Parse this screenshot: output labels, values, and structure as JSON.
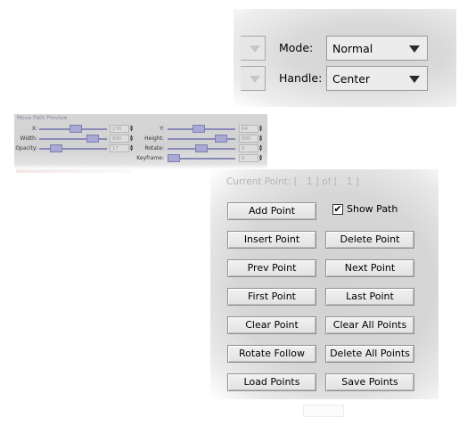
{
  "mode_panel": {
    "mode_label": "Mode:",
    "mode_value": "Normal",
    "handle_label": "Handle:",
    "handle_value": "Center"
  },
  "preview": {
    "title": "Move Path Preview",
    "fields": {
      "x": {
        "label": "X:",
        "value": "176",
        "slider": 0.55
      },
      "width": {
        "label": "Width:",
        "value": "800",
        "slider": 0.85
      },
      "opacity": {
        "label": "Opacity:",
        "value": "17",
        "slider": 0.2
      },
      "y": {
        "label": "Y:",
        "value": "64",
        "slider": 0.45
      },
      "height": {
        "label": "Height:",
        "value": "800",
        "slider": 0.85
      },
      "rotate": {
        "label": "Rotate:",
        "value": "0",
        "slider": 0.5
      },
      "keyframe": {
        "label": "Keyframe:",
        "value": "0",
        "slider": 0.0
      }
    }
  },
  "points": {
    "current_label": "Current Point:",
    "current_value": "1",
    "of_label": "of",
    "total_value": "1",
    "buttons": {
      "add_point": "Add Point",
      "show_path": "Show Path",
      "insert_point": "Insert Point",
      "delete_point": "Delete Point",
      "prev_point": "Prev Point",
      "next_point": "Next Point",
      "first_point": "First Point",
      "last_point": "Last Point",
      "clear_point": "Clear Point",
      "clear_all_points": "Clear All Points",
      "rotate_follow": "Rotate Follow",
      "delete_all_points": "Delete All Points",
      "load_points": "Load Points",
      "save_points": "Save Points"
    },
    "show_path_checked": true
  },
  "icons": {
    "dropdown": "chevron-down-icon",
    "checkbox": "checkmark-icon"
  }
}
